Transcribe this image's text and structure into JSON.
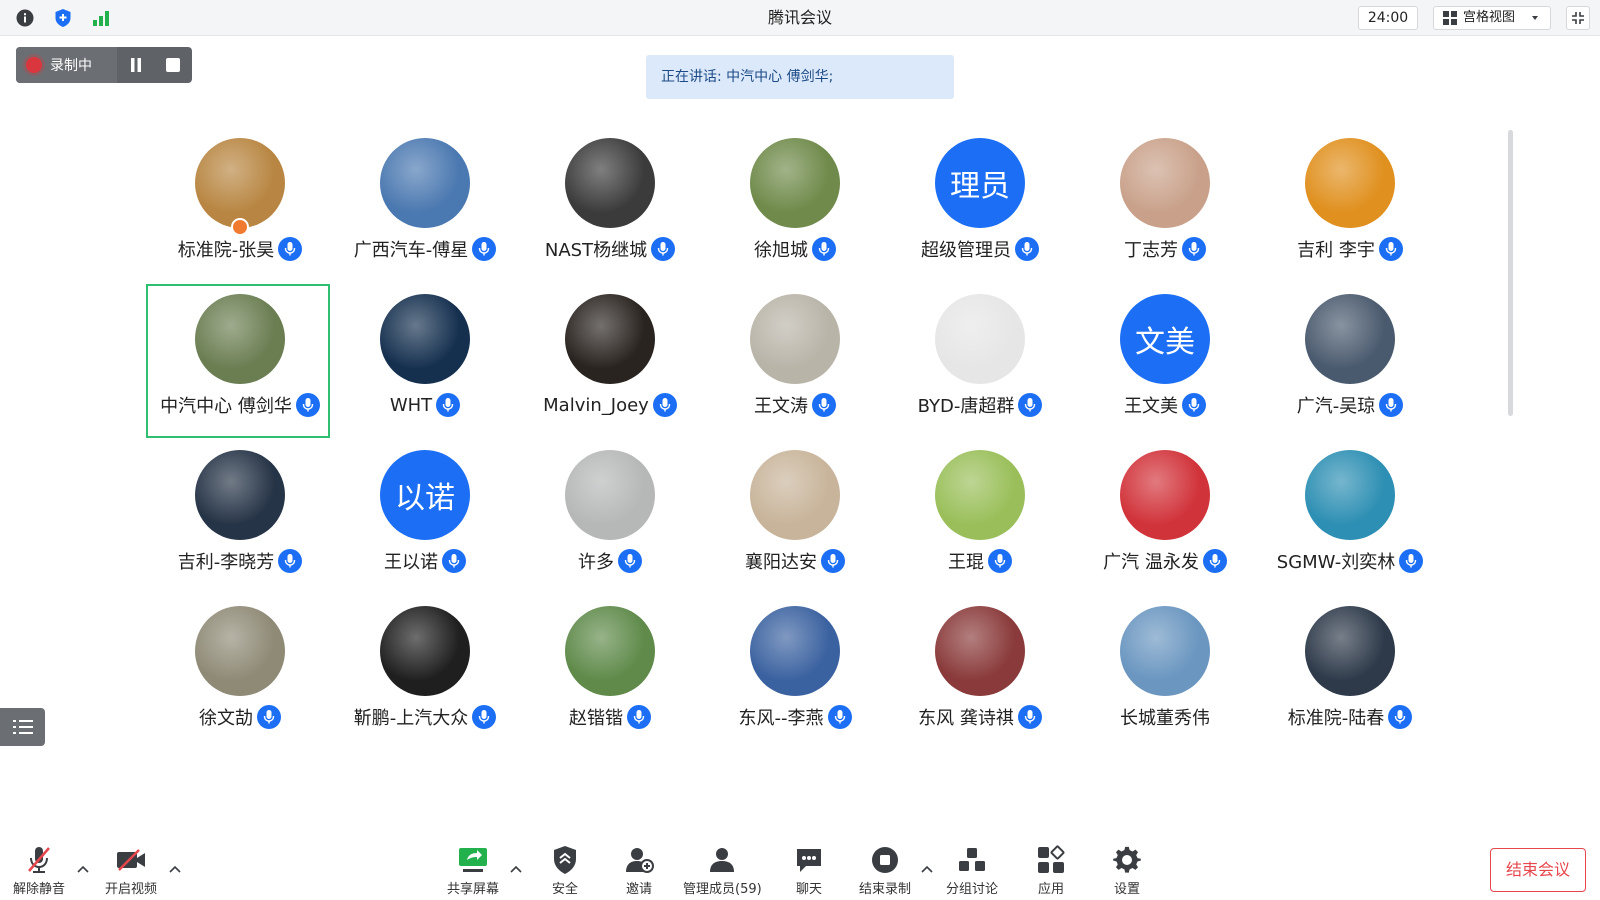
{
  "window": {
    "title": "腾讯会议",
    "time": "24:00",
    "view_label": "宫格视图"
  },
  "recording": {
    "label": "录制中"
  },
  "speaking_banner": "正在讲话: 中汽中心 傅剑华;",
  "participants": [
    {
      "name": "标准院-张昊",
      "avatar_type": "photo",
      "color": "#b88642",
      "host": true
    },
    {
      "name": "广西汽车-傅星",
      "avatar_type": "photo",
      "color": "#4a78b0"
    },
    {
      "name": "NAST杨继城",
      "avatar_type": "photo",
      "color": "#3b3b3b"
    },
    {
      "name": "徐旭城",
      "avatar_type": "photo",
      "color": "#6f8a4a"
    },
    {
      "name": "超级管理员",
      "avatar_type": "text",
      "avatar_text": "理员"
    },
    {
      "name": "丁志芳",
      "avatar_type": "photo",
      "color": "#c9a18a"
    },
    {
      "name": "吉利 李宇",
      "avatar_type": "photo",
      "color": "#e0901e"
    },
    {
      "name": "中汽中心 傅剑华",
      "avatar_type": "photo",
      "color": "#6b7e52",
      "active": true
    },
    {
      "name": "WHT",
      "avatar_type": "photo",
      "color": "#15304f"
    },
    {
      "name": "Malvin_Joey",
      "avatar_type": "photo",
      "color": "#2a2420"
    },
    {
      "name": "王文涛",
      "avatar_type": "photo",
      "color": "#b9b4a8"
    },
    {
      "name": "BYD-唐超群",
      "avatar_type": "photo",
      "color": "#e6e6e6"
    },
    {
      "name": "王文美",
      "avatar_type": "text",
      "avatar_text": "文美"
    },
    {
      "name": "广汽-吴琼",
      "avatar_type": "photo",
      "color": "#4a5a6e"
    },
    {
      "name": "吉利-李晓芳",
      "avatar_type": "photo",
      "color": "#263447"
    },
    {
      "name": "王以诺",
      "avatar_type": "text",
      "avatar_text": "以诺"
    },
    {
      "name": "许多",
      "avatar_type": "photo",
      "color": "#b5b8b6"
    },
    {
      "name": "襄阳达安",
      "avatar_type": "photo",
      "color": "#c8b49a"
    },
    {
      "name": "王琨",
      "avatar_type": "photo",
      "color": "#9abf5a"
    },
    {
      "name": "广汽 温永发",
      "avatar_type": "photo",
      "color": "#d1333a"
    },
    {
      "name": "SGMW-刘奕林",
      "avatar_type": "photo",
      "color": "#2d8fb3"
    },
    {
      "name": "徐文劼",
      "avatar_type": "photo",
      "color": "#8f8a76"
    },
    {
      "name": "靳鹏-上汽大众",
      "avatar_type": "photo",
      "color": "#1f1f1f"
    },
    {
      "name": "赵锴锴",
      "avatar_type": "photo",
      "color": "#5f8a4a"
    },
    {
      "name": "东风--李燕",
      "avatar_type": "photo",
      "color": "#3b62a0"
    },
    {
      "name": "东风 龚诗祺",
      "avatar_type": "photo",
      "color": "#8a3a3a"
    },
    {
      "name": "长城董秀伟",
      "avatar_type": "photo",
      "color": "#6a96c0",
      "no_mic": true
    },
    {
      "name": "标准院-陆春",
      "avatar_type": "photo",
      "color": "#2e3a4a"
    }
  ],
  "toolbar": {
    "unmute": "解除静音",
    "video": "开启视频",
    "share": "共享屏幕",
    "security": "安全",
    "invite": "邀请",
    "members": "管理成员(59)",
    "chat": "聊天",
    "end_record": "结束录制",
    "breakout": "分组讨论",
    "apps": "应用",
    "settings": "设置",
    "end_meeting": "结束会议"
  },
  "colors": {
    "accent": "#1c6ff4",
    "danger": "#e6474d",
    "active_border": "#2fbf71"
  }
}
